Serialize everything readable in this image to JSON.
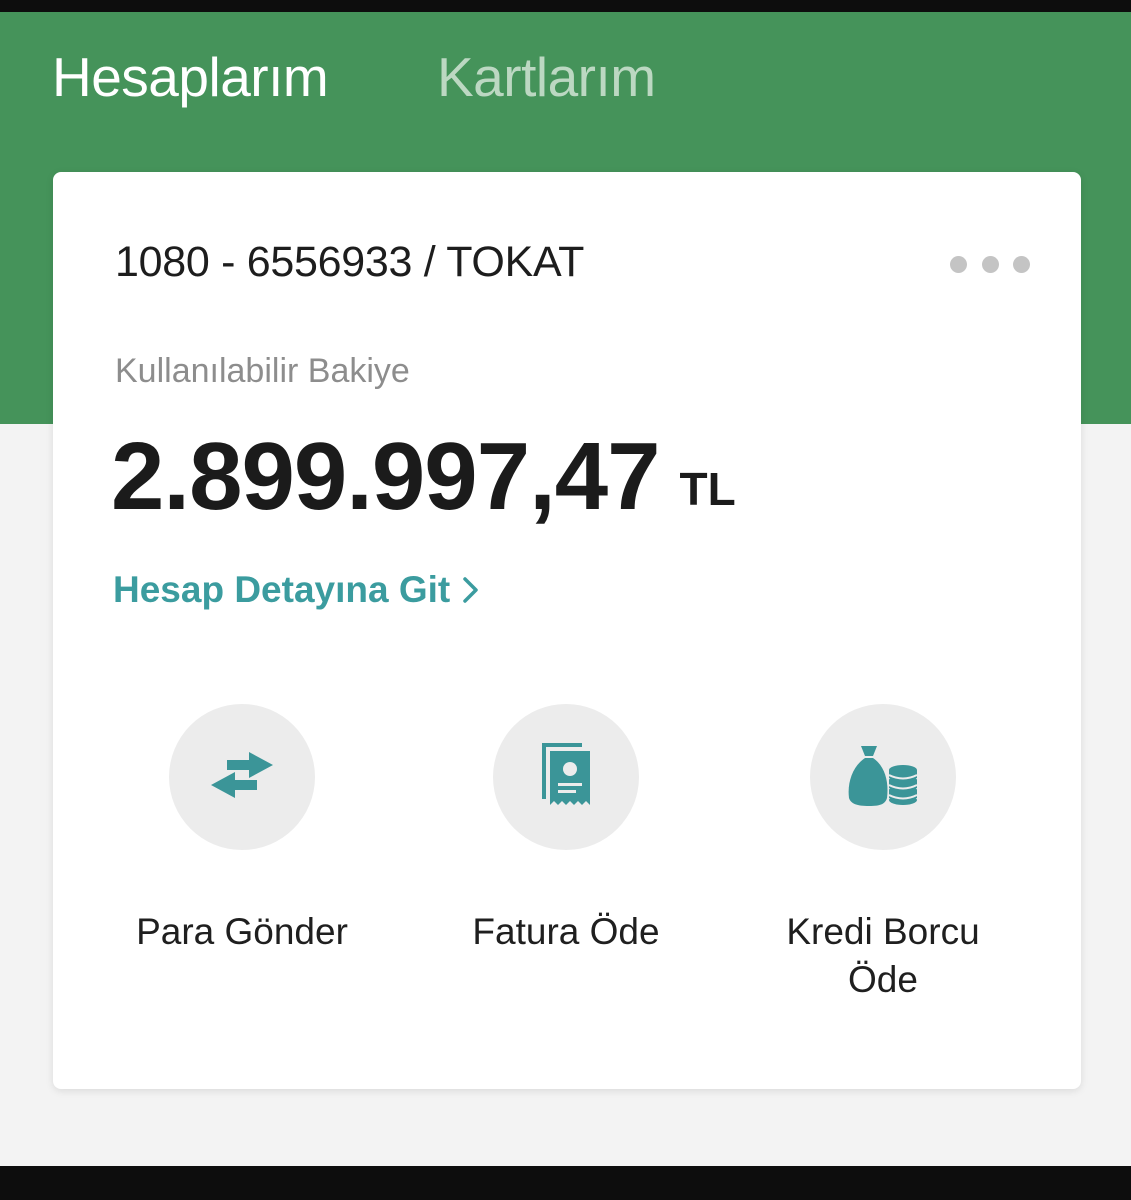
{
  "tabs": {
    "active": "Hesaplarım",
    "inactive": "Kartlarım"
  },
  "account": {
    "number": "1080 - 6556933 / TOKAT",
    "balance_label": "Kullanılabilir Bakiye",
    "balance": "2.899.997,47",
    "currency": "TL",
    "detail_link": "Hesap Detayına Git"
  },
  "actions": [
    {
      "label": "Para Gönder",
      "icon": "transfer-icon"
    },
    {
      "label": "Fatura Öde",
      "icon": "bill-icon"
    },
    {
      "label": "Kredi Borcu Öde",
      "icon": "money-bag-coins-icon"
    }
  ],
  "colors": {
    "header_green": "#45935a",
    "accent_teal": "#3b9c9f",
    "icon_teal": "#3b9598",
    "inactive_tab": "#bcd8c2"
  }
}
